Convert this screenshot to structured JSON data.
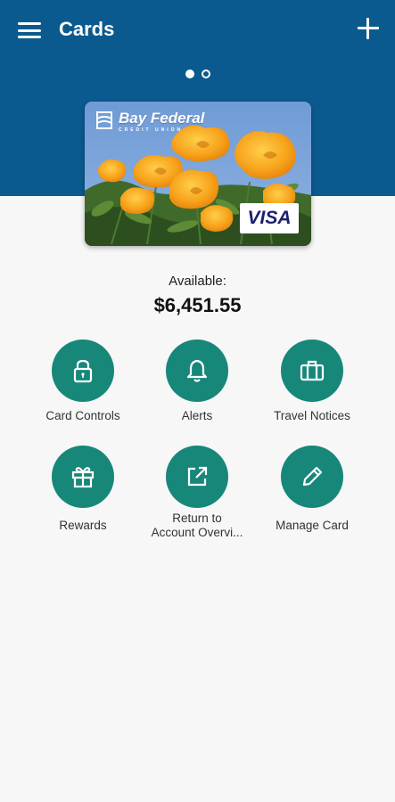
{
  "appbar": {
    "title": "Cards",
    "menu_icon": "hamburger-menu-icon",
    "add_icon": "plus-icon"
  },
  "carousel": {
    "pages": 2,
    "active_page": 1
  },
  "card": {
    "issuer_name": "Bay Federal",
    "issuer_sub": "CREDIT UNION",
    "network": "VISA",
    "image": "california-poppies"
  },
  "balance": {
    "label": "Available:",
    "amount": "$6,451.55"
  },
  "actions": [
    {
      "label": "Card Controls",
      "icon": "lock-icon"
    },
    {
      "label": "Alerts",
      "icon": "bell-icon"
    },
    {
      "label": "Travel Notices",
      "icon": "suitcase-icon"
    },
    {
      "label": "Rewards",
      "icon": "gift-icon"
    },
    {
      "label": "Return to\nAccount Overvi...",
      "icon": "external-link-icon"
    },
    {
      "label": "Manage Card",
      "icon": "pencil-icon"
    }
  ],
  "colors": {
    "header": "#0b5a8f",
    "accent": "#17877a",
    "background": "#f7f7f7"
  }
}
